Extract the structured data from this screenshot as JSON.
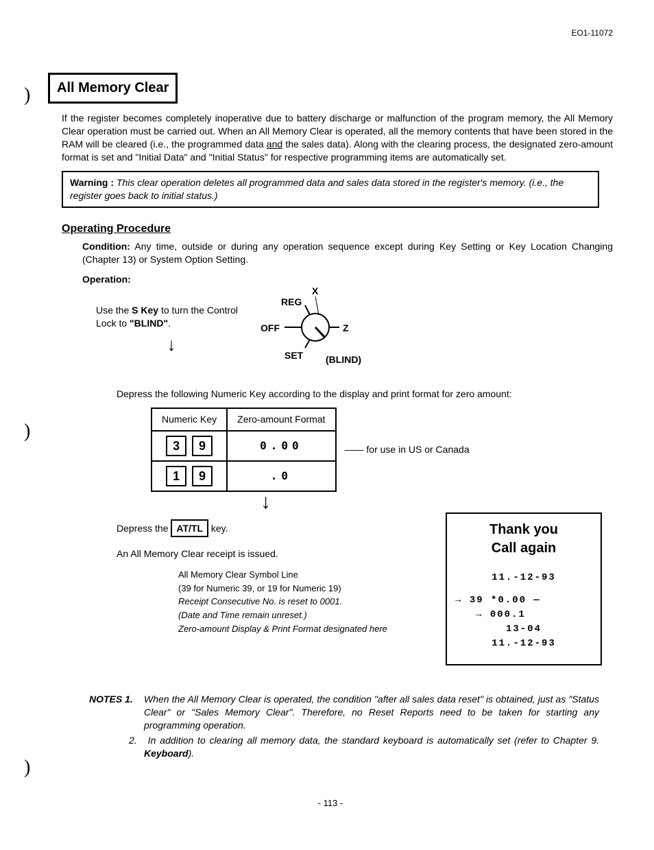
{
  "doc_id": "EO1-11072",
  "section_title": "All Memory Clear",
  "intro": "If the register becomes completely inoperative due to battery discharge or malfunction of the program memory, the All Memory Clear operation must be carried out. When an All Memory Clear is operated, all the memory contents that have been stored in the RAM will be cleared (i.e., the programmed data and the sales data). Along with the clearing process, the designated zero-amount format is set and \"Initial Data\" and \"Initial Status\" for respective programming items are automatically set.",
  "intro_underlined_word": "and",
  "warning_label": "Warning :",
  "warning_text": "This clear operation deletes all programmed data and sales data stored in the register's memory. (i.e., the register goes back to initial status.)",
  "op_heading": "Operating Procedure",
  "condition_label": "Condition:",
  "condition_text": "Any time, outside or during any operation sequence except during Key Setting or Key Location Changing (Chapter 13) or System Option Setting.",
  "operation_label": "Operation:",
  "step1a": "Use the ",
  "step1b": "S Key",
  "step1c": " to turn the Control Lock to ",
  "step1d": "\"BLIND\"",
  "dial": {
    "x": "X",
    "reg": "REG",
    "off": "OFF",
    "z": "Z",
    "set": "SET",
    "blind": "(BLIND)"
  },
  "depress_intro": "Depress the following Numeric Key according to the display and print format for zero amount:",
  "table": {
    "h1": "Numeric Key",
    "h2": "Zero-amount Format",
    "rows": [
      {
        "k1": "3",
        "k2": "9",
        "fmt": "0.00",
        "note": "for use in US or Canada"
      },
      {
        "k1": "1",
        "k2": "9",
        "fmt": ".0",
        "note": ""
      }
    ]
  },
  "depress_attl_a": "Depress the ",
  "depress_attl_key": "AT/TL",
  "depress_attl_b": " key.",
  "issued": "An All Memory Clear receipt is issued.",
  "receipt_notes": {
    "n1": "All Memory Clear Symbol Line",
    "n2": "(39 for Numeric 39, or 19 for Numeric 19)",
    "n3": "Receipt Consecutive No. is reset to 0001.",
    "n4": "(Date and Time remain unreset.)",
    "n5": "Zero-amount Display & Print Format designated here"
  },
  "receipt": {
    "l1": "Thank you",
    "l2": "Call  again",
    "date": "11.-12-93",
    "amt": "39   *0.00",
    "cons": "000.1",
    "time": "13-04",
    "date2": "11.-12-93"
  },
  "notes_label": "NOTES",
  "note1num": "1.",
  "note1": "When the All Memory Clear is operated, the condition \"after all sales data reset\" is obtained, just as \"Status Clear\" or \"Sales Memory Clear\". Therefore, no Reset Reports need to be taken for starting any programming operation.",
  "note2num": "2.",
  "note2a": "In addition to clearing all memory data, the standard keyboard is automatically set (refer to Chapter 9. ",
  "note2b": "Keyboard",
  "note2c": ").",
  "page": "- 113 -"
}
